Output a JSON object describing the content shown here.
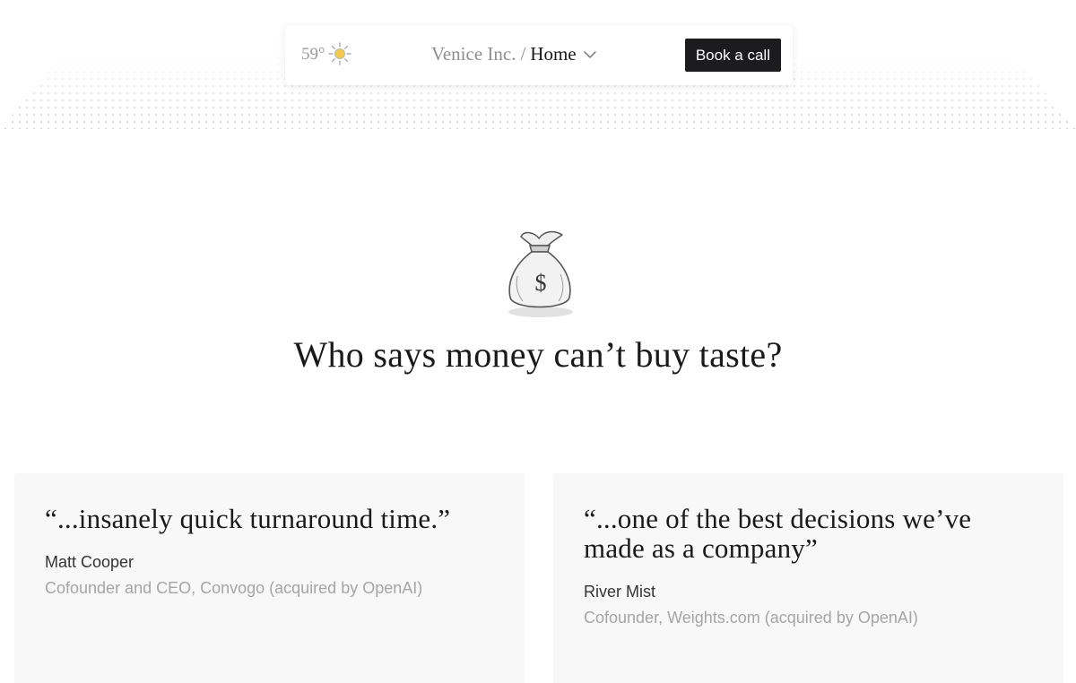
{
  "header": {
    "temperature": "59°",
    "weather_icon": "sun-icon",
    "company": "Venice Inc.",
    "separator": "/",
    "current_page": "Home",
    "cta_label": "Book a call"
  },
  "hero": {
    "icon": "money-bag-icon",
    "title": "Who says money can’t buy taste?"
  },
  "testimonials": [
    {
      "quote": "“...insanely quick turnaround time.”",
      "name": "Matt Cooper",
      "role": "Cofounder and CEO, Convogo (acquired by OpenAI)"
    },
    {
      "quote": "“...one of the best decisions we’ve made as a company”",
      "name": "River Mist",
      "role": "Cofounder, Weights.com (acquired by OpenAI)"
    }
  ],
  "colors": {
    "button_bg": "#1c1c1e",
    "card_bg": "#f8f8f8",
    "muted_text": "#a5a5a5",
    "sun": "#f5c94a"
  }
}
